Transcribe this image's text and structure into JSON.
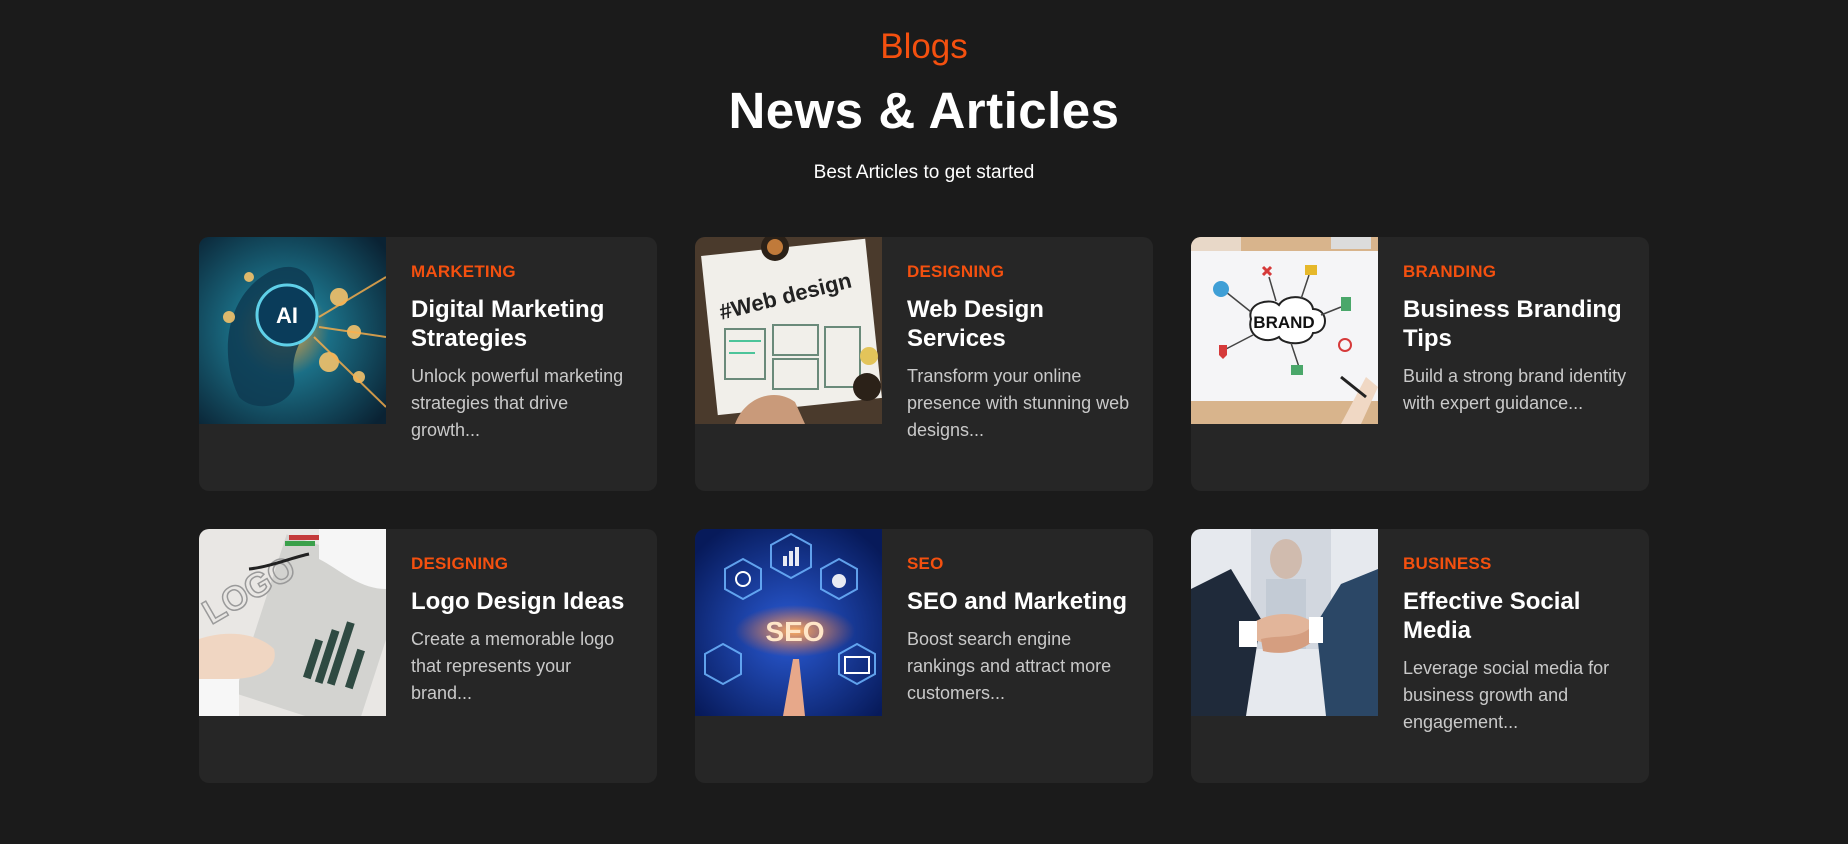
{
  "header": {
    "eyebrow": "Blogs",
    "title": "News & Articles",
    "subtitle": "Best Articles to get started"
  },
  "colors": {
    "accent": "#f4500f",
    "background": "#1b1b1b",
    "card": "#262626"
  },
  "articles": [
    {
      "category": "MARKETING",
      "title": "Digital Marketing Strategies",
      "excerpt": "Unlock powerful marketing strategies that drive growth...",
      "image": "ai-marketing-illustration",
      "image_text": "AI"
    },
    {
      "category": "DESIGNING",
      "title": "Web Design Services",
      "excerpt": "Transform your online presence with stunning web designs...",
      "image": "web-design-sketch",
      "image_text": "#Web design"
    },
    {
      "category": "BRANDING",
      "title": "Business Branding Tips",
      "excerpt": "Build a strong brand identity with expert guidance...",
      "image": "brand-mindmap",
      "image_text": "BRAND"
    },
    {
      "category": "DESIGNING",
      "title": "Logo Design Ideas",
      "excerpt": "Create a memorable logo that represents your brand...",
      "image": "logo-sketching",
      "image_text": "LOGO"
    },
    {
      "category": "SEO",
      "title": "SEO and Marketing",
      "excerpt": "Boost search engine rankings and attract more customers...",
      "image": "seo-hexagons",
      "image_text": "SEO"
    },
    {
      "category": "BUSINESS",
      "title": "Effective Social Media",
      "excerpt": "Leverage social media for business growth and engagement...",
      "image": "business-handshake",
      "image_text": ""
    }
  ]
}
